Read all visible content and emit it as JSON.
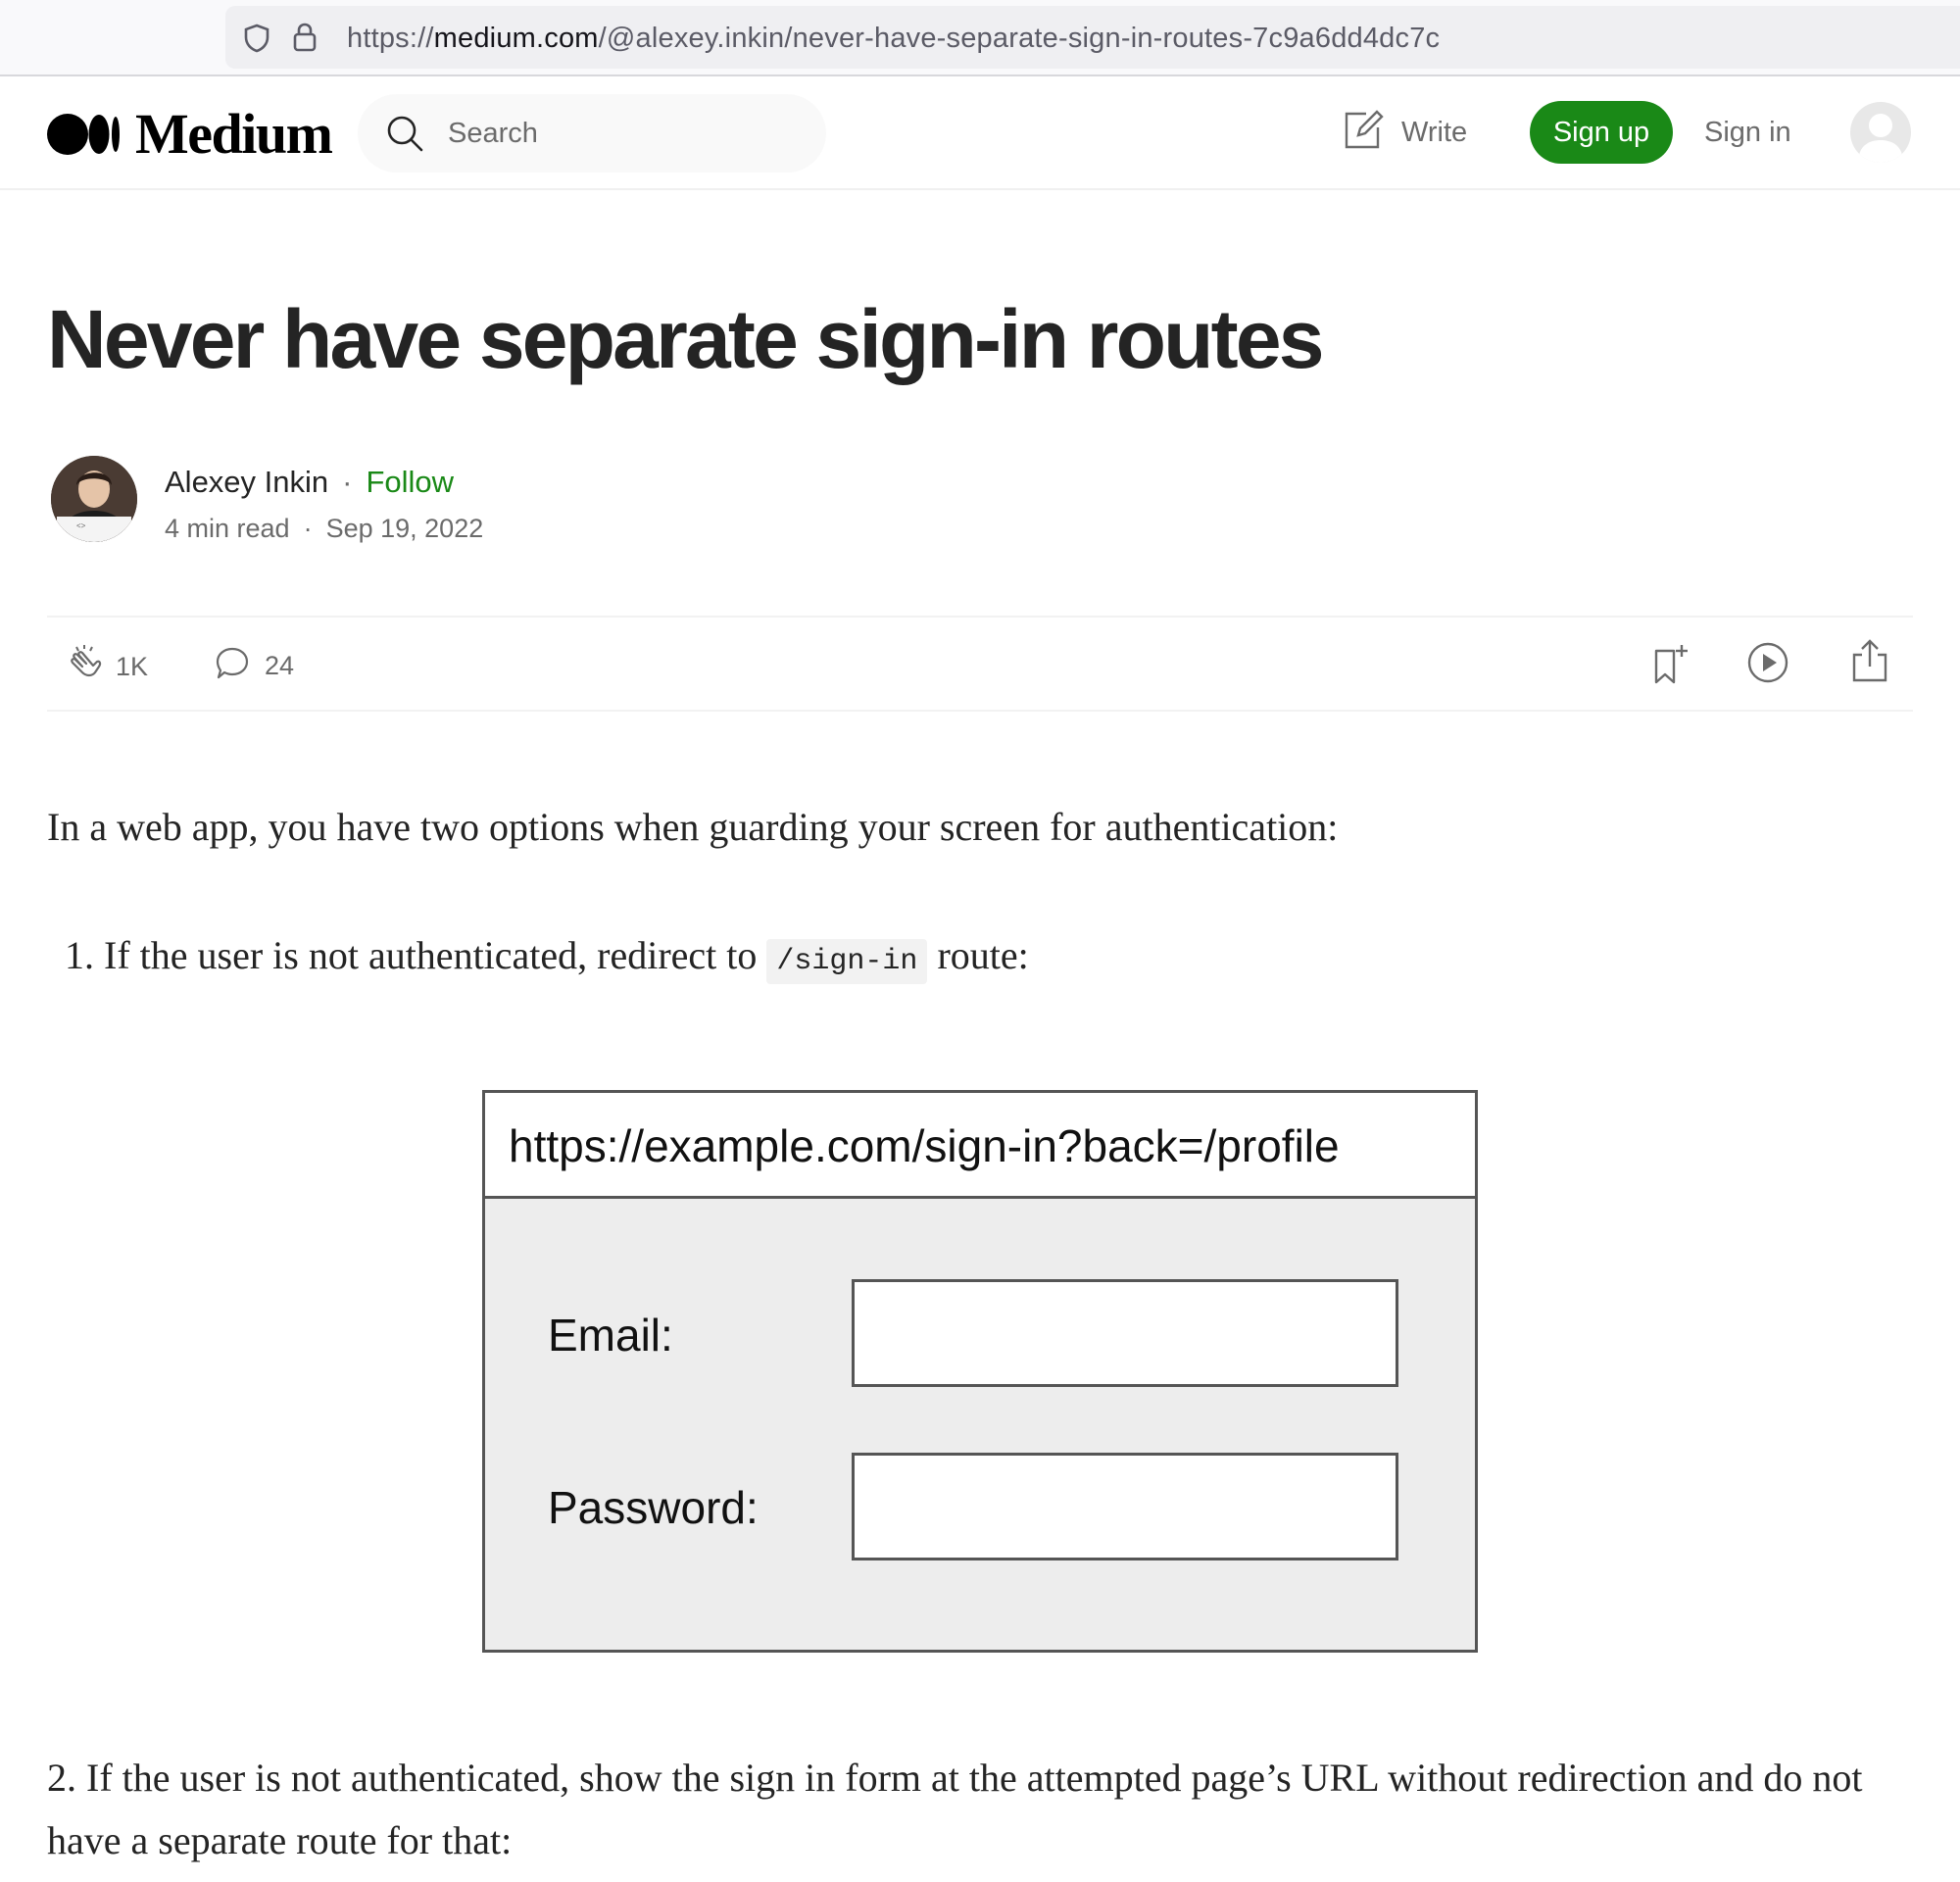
{
  "browser": {
    "url_prefix": "https://",
    "url_host": "medium.com",
    "url_path": "/@alexey.inkin/never-have-separate-sign-in-routes-7c9a6dd4dc7c"
  },
  "header": {
    "logo_text": "Medium",
    "search_placeholder": "Search",
    "write_label": "Write",
    "signup_label": "Sign up",
    "signin_label": "Sign in"
  },
  "article": {
    "title": "Never have separate sign-in routes",
    "author": "Alexey Inkin",
    "separator": "·",
    "follow_label": "Follow",
    "read_time": "4 min read",
    "date": "Sep 19, 2022",
    "claps": "1K",
    "responses": "24",
    "intro": "In a web app, you have two options when guarding your screen for authentication:",
    "item1_prefix": "1. If the user is not authenticated, redirect to",
    "item1_code": "/sign-in",
    "item1_suffix": "route:",
    "item2": "2. If the user is not authenticated, show the sign in form at the attempted page’s URL without redirection and do not have a separate route for that:"
  },
  "figure": {
    "url": "https://example.com/sign-in?back=/profile",
    "email_label": "Email:",
    "password_label": "Password:"
  },
  "colors": {
    "brand_green": "#1a8917",
    "text": "#242424",
    "muted": "#6b6b6b"
  }
}
